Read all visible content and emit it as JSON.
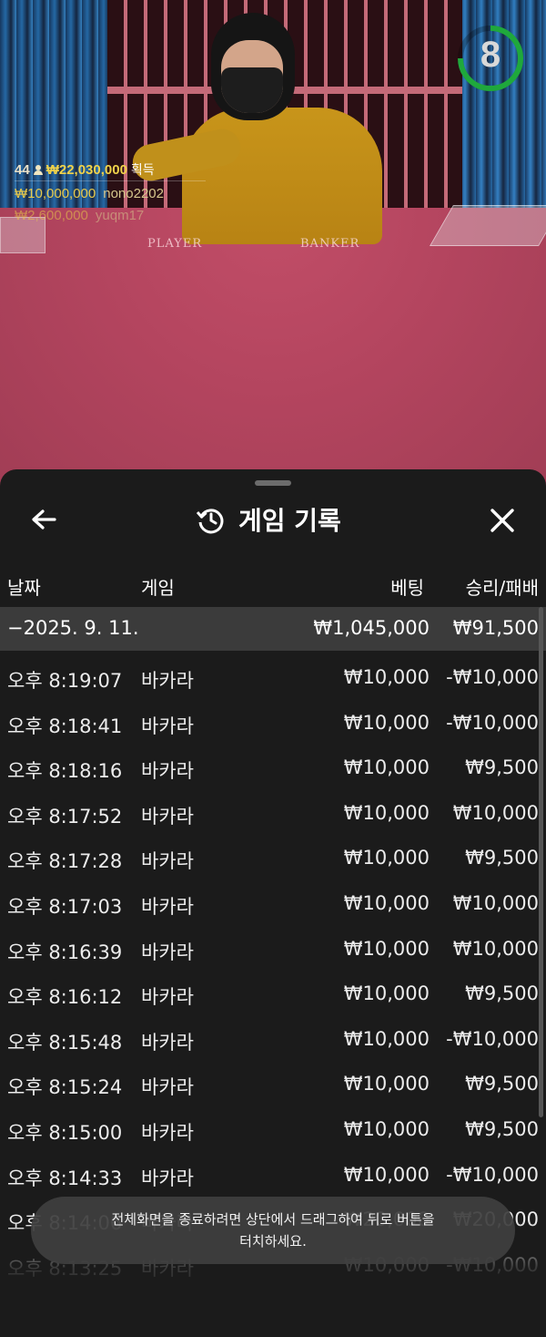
{
  "live": {
    "timer": "8",
    "timer_progress": 0.75,
    "felt_left": "PLAYER",
    "felt_right": "BANKER",
    "winners": {
      "count": "44",
      "total": "₩22,030,000",
      "suffix": "획득",
      "entries": [
        {
          "amount": "₩10,000,000",
          "name": "nono2202"
        },
        {
          "amount": "₩2,600,000",
          "name": "yuqm17"
        }
      ]
    }
  },
  "sheet": {
    "title": "게임 기록",
    "columns": {
      "date": "날짜",
      "game": "게임",
      "bet": "베팅",
      "result": "승리/패배"
    },
    "day": {
      "date": "−2025. 9. 11.",
      "bet": "₩1,045,000",
      "result": "₩91,500"
    },
    "rows": [
      {
        "time": "오후 8:19:07",
        "game": "바카라",
        "bet": "₩10,000",
        "result": "-₩10,000"
      },
      {
        "time": "오후 8:18:41",
        "game": "바카라",
        "bet": "₩10,000",
        "result": "-₩10,000"
      },
      {
        "time": "오후 8:18:16",
        "game": "바카라",
        "bet": "₩10,000",
        "result": "₩9,500"
      },
      {
        "time": "오후 8:17:52",
        "game": "바카라",
        "bet": "₩10,000",
        "result": "₩10,000"
      },
      {
        "time": "오후 8:17:28",
        "game": "바카라",
        "bet": "₩10,000",
        "result": "₩9,500"
      },
      {
        "time": "오후 8:17:03",
        "game": "바카라",
        "bet": "₩10,000",
        "result": "₩10,000"
      },
      {
        "time": "오후 8:16:39",
        "game": "바카라",
        "bet": "₩10,000",
        "result": "₩10,000"
      },
      {
        "time": "오후 8:16:12",
        "game": "바카라",
        "bet": "₩10,000",
        "result": "₩9,500"
      },
      {
        "time": "오후 8:15:48",
        "game": "바카라",
        "bet": "₩10,000",
        "result": "-₩10,000"
      },
      {
        "time": "오후 8:15:24",
        "game": "바카라",
        "bet": "₩10,000",
        "result": "₩9,500"
      },
      {
        "time": "오후 8:15:00",
        "game": "바카라",
        "bet": "₩10,000",
        "result": "₩9,500"
      },
      {
        "time": "오후 8:14:33",
        "game": "바카라",
        "bet": "₩10,000",
        "result": "-₩10,000"
      },
      {
        "time": "오후 8:14:06",
        "game": "바카라",
        "bet": "₩20,000",
        "result": "₩20,000"
      },
      {
        "time": "오후 8:13:25",
        "game": "바카라",
        "bet": "₩10,000",
        "result": "-₩10,000"
      }
    ]
  },
  "toast": {
    "line1": "전체화면을 종료하려면 상단에서 드래그하여 뒤로 버튼을",
    "line2": "터치하세요."
  },
  "icons": {
    "back": "arrow-left-icon",
    "history": "history-icon",
    "close": "close-icon",
    "user": "user-icon"
  },
  "colors": {
    "timer_ring": "#1fa83c",
    "winner_gold": "#f0d24a",
    "sheet_bg": "#1b1b1b",
    "day_row_bg": "#3b3b3b"
  }
}
